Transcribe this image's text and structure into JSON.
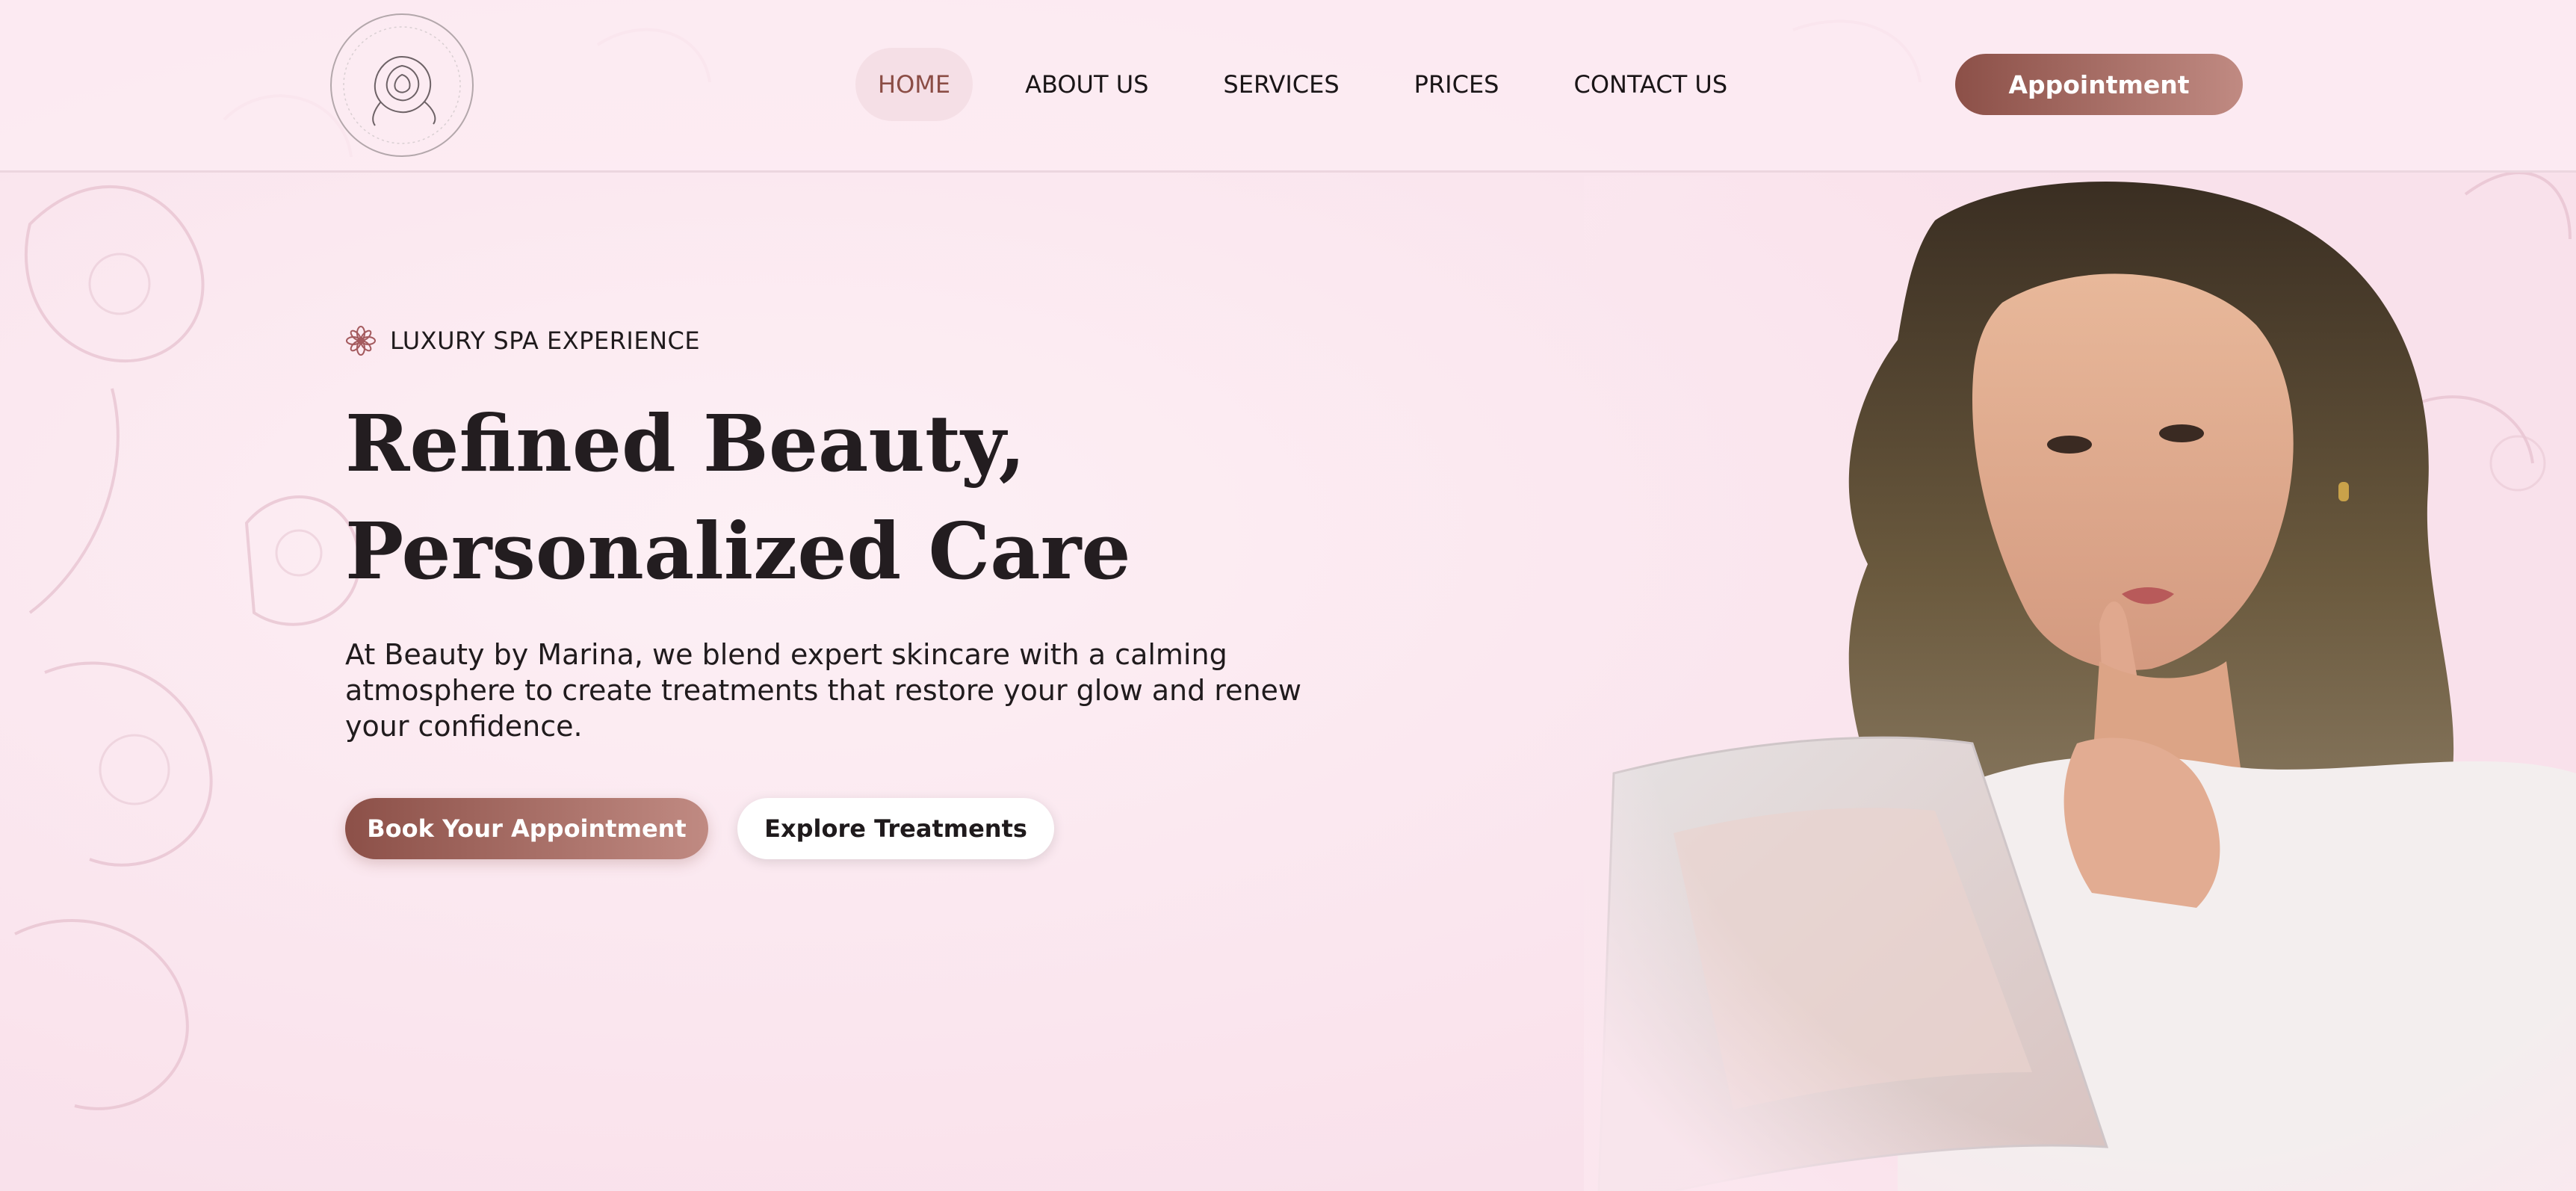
{
  "brand": {
    "logo_icon": "rose-logo-icon"
  },
  "nav": {
    "items": [
      {
        "label": "HOME",
        "active": true
      },
      {
        "label": "ABOUT US"
      },
      {
        "label": "SERVICES"
      },
      {
        "label": "PRICES"
      },
      {
        "label": "CONTACT US"
      }
    ],
    "appointment_label": "Appointment"
  },
  "hero": {
    "eyebrow_icon": "flower-icon",
    "eyebrow": "LUXURY SPA EXPERIENCE",
    "title_line1": "Refined Beauty,",
    "title_line2": "Personalized Care",
    "description": "At Beauty by Marina, we blend expert skincare with a calming atmosphere to create treatments that restore your glow and renew your confidence.",
    "primary_cta": "Book Your Appointment",
    "secondary_cta": "Explore Treatments",
    "image": "woman-with-magazine-portrait"
  },
  "colors": {
    "background": "#fbe7ef",
    "accent_start": "#8c5048",
    "accent_end": "#c08a82",
    "text": "#1f1a1c",
    "nav_active_bg": "#f5dfe6",
    "nav_active_text": "#8b4d45"
  }
}
